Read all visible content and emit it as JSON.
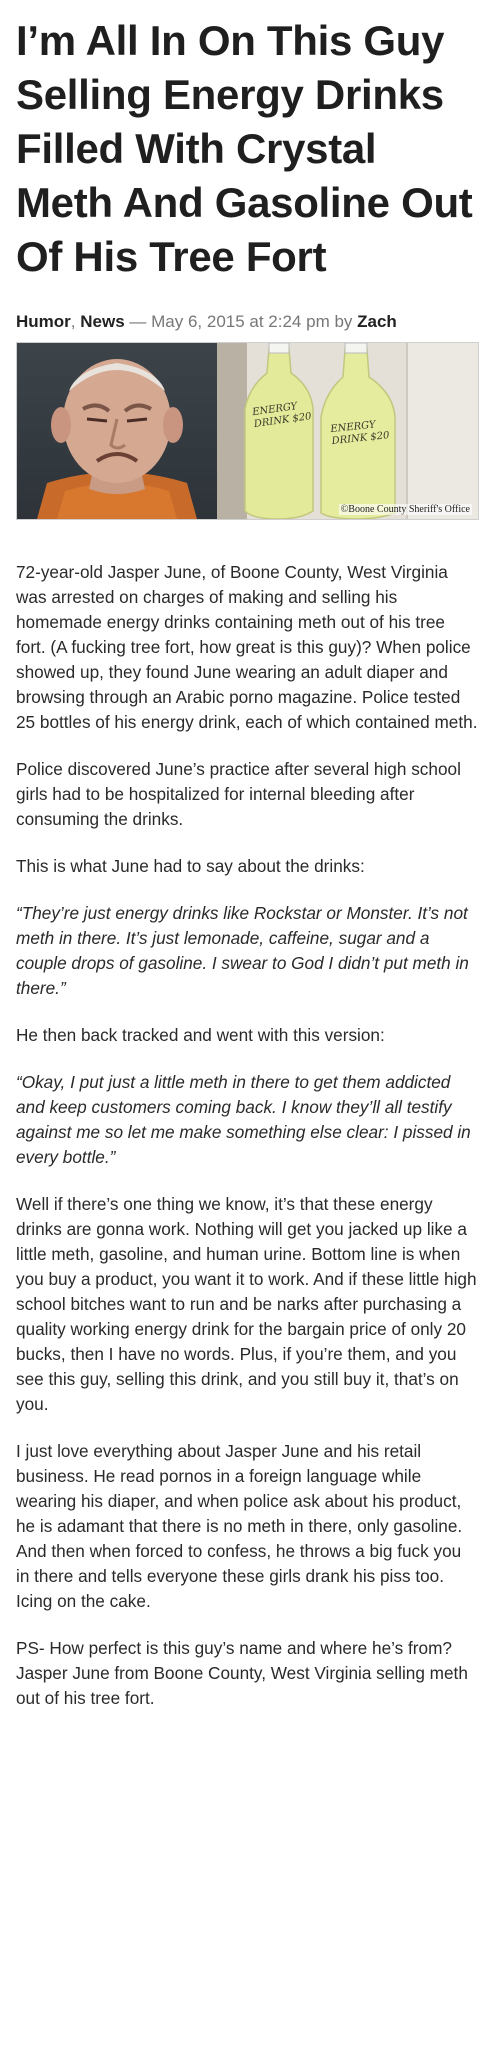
{
  "article": {
    "title": "I’m All In On This Guy Selling Energy Drinks Filled With Crystal Meth And Gasoline Out Of His Tree Fort",
    "meta": {
      "category_1": "Humor",
      "comma": ",",
      "category_2": "News",
      "dash_date": " — May 6, 2015 at 2:24 pm by ",
      "author": "Zach"
    },
    "image": {
      "bottle_1_label": "ENERGY DRINK $20",
      "bottle_2_label": "ENERGY DRINK $20",
      "credit": "©Boone County Sheriff's Office"
    },
    "paragraphs": [
      {
        "text": "72-year-old Jasper June, of Boone County, West Virginia was arrested on charges of making and selling his homemade energy drinks containing meth out of his tree fort. (A fucking tree fort, how great is this guy)? When police showed up, they found June wearing an adult diaper and browsing through an Arabic porno magazine. Police tested 25 bottles of his energy drink, each of which contained meth."
      },
      {
        "text": "Police discovered June’s practice after several high school girls had to be hospitalized for internal bleeding after consuming the drinks."
      },
      {
        "text": "This is what June had to say about the drinks:"
      },
      {
        "text": "“They’re just energy drinks like Rockstar or Monster. It’s not meth in there. It’s just lemonade, caffeine, sugar and a couple drops of gasoline. I swear to God I didn’t put meth in there.”",
        "quote": true
      },
      {
        "text": "He then back tracked and went with this version:"
      },
      {
        "text": "“Okay, I put just a little meth in there to get them addicted and keep customers coming back. I know they’ll all testify against me so let me make something else clear: I pissed in every bottle.”",
        "quote": true
      },
      {
        "text": "Well if there’s one thing we know, it’s that these energy drinks are gonna work. Nothing will get you jacked up like a little meth, gasoline, and human urine. Bottom line is when you buy a product, you want it to work. And if these little high school bitches want to run and be narks after purchasing a quality working energy drink for the bargain price of only 20 bucks, then I have no words. Plus, if you’re them, and you see this guy, selling this drink, and you still buy it, that’s on you."
      },
      {
        "text": "I just love everything about Jasper June and his retail business. He read pornos in a foreign language while wearing his diaper, and when police ask about his product, he is adamant that there is no meth in there, only gasoline. And then when forced to confess, he throws a big fuck you in there and tells everyone these girls drank his piss too. Icing on the cake."
      },
      {
        "text": "PS- How perfect is this guy’s name and where he’s from? Jasper June from Boone County, West Virginia selling meth out of his tree fort."
      }
    ]
  }
}
